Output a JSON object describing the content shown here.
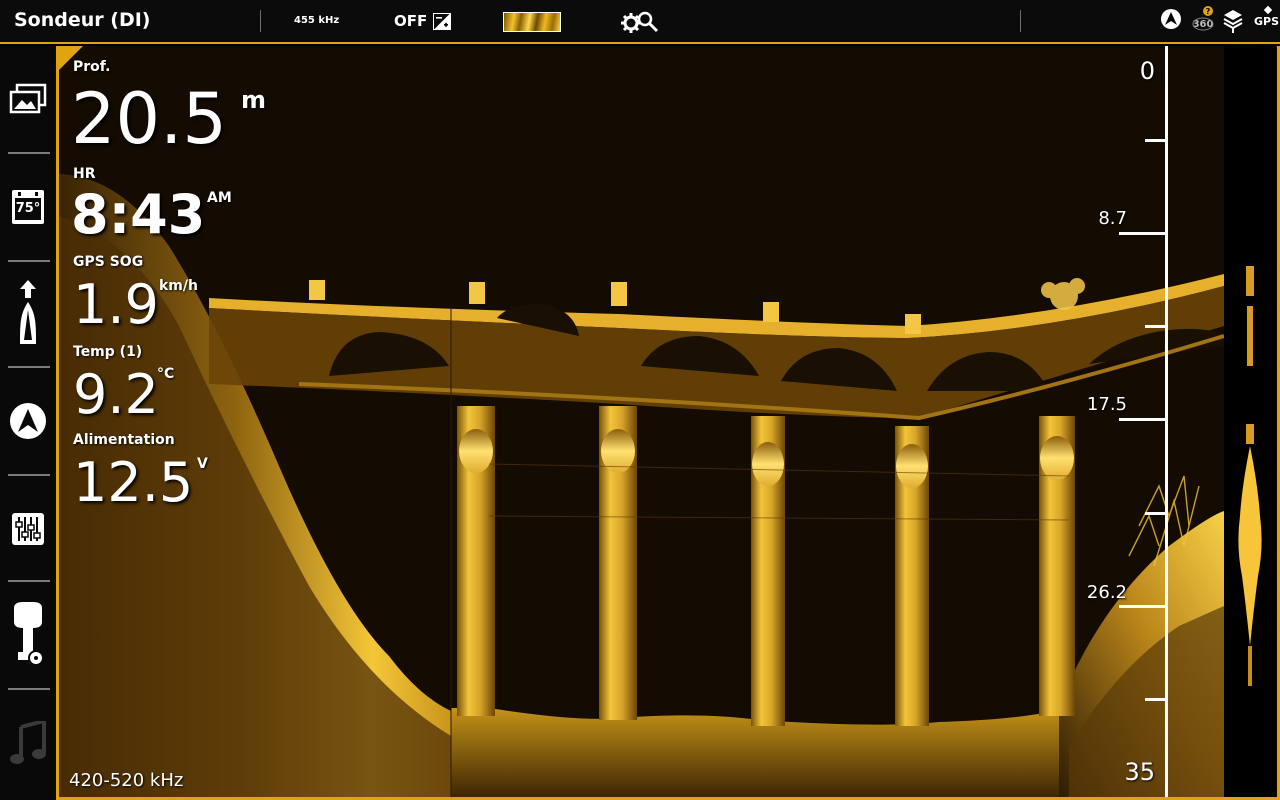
{
  "topbar": {
    "title": "Sondeur (DI)",
    "frequency": "455 kHz",
    "sonar_status": "OFF",
    "gps_label": "GPS"
  },
  "sidebar": {
    "items": [
      {
        "name": "views",
        "icon": "gallery-icon"
      },
      {
        "name": "temperature",
        "icon": "thermometer-icon",
        "label": "75°"
      },
      {
        "name": "navigation",
        "icon": "boat-icon"
      },
      {
        "name": "chart",
        "icon": "compass-icon"
      },
      {
        "name": "settings",
        "icon": "sliders-icon"
      },
      {
        "name": "motor",
        "icon": "trolling-motor-icon"
      },
      {
        "name": "music",
        "icon": "music-note-icon"
      }
    ]
  },
  "readouts": {
    "depth": {
      "label": "Prof.",
      "value": "20.5",
      "unit": "m"
    },
    "time": {
      "label": "HR",
      "value": "8:43",
      "unit": "AM"
    },
    "speed": {
      "label": "GPS SOG",
      "value": "1.9",
      "unit": "km/h"
    },
    "temp": {
      "label": "Temp (1)",
      "value": "9.2",
      "unit": "°C"
    },
    "power": {
      "label": "Alimentation",
      "value": "12.5",
      "unit": "V"
    }
  },
  "frequency_range": "420-520 kHz",
  "depth_scale": {
    "top": "0",
    "mid1": "8.7",
    "mid2": "17.5",
    "mid3": "26.2",
    "bottom": "35"
  },
  "colors": {
    "accent": "#e0a410",
    "sonar_bright": "#f7c52a",
    "sonar_dark": "#130a03"
  }
}
